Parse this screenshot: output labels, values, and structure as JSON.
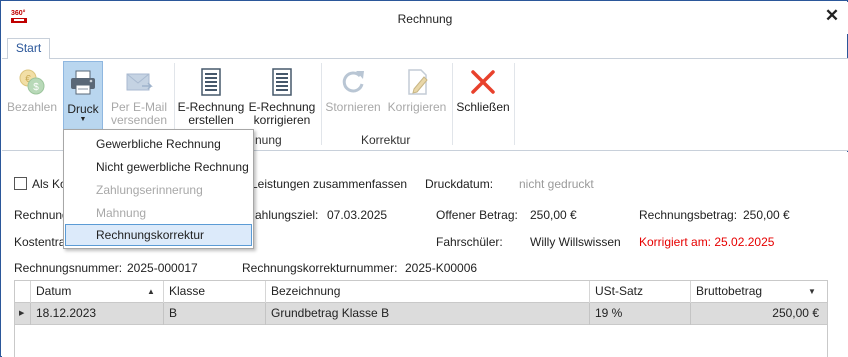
{
  "window": {
    "title": "Rechnung",
    "logo_text": "360°"
  },
  "tabs": [
    {
      "label": "Start"
    }
  ],
  "ribbon": {
    "bezahlen": "Bezahlen",
    "druck": "Druck",
    "email_line1": "Per E-Mail",
    "email_line2": "versenden",
    "erechnung_erstellen_1": "E-Rechnung",
    "erechnung_erstellen_2": "erstellen",
    "erechnung_korrigieren_1": "E-Rechnung",
    "erechnung_korrigieren_2": "korrigieren",
    "stornieren": "Stornieren",
    "korrigieren": "Korrigieren",
    "schliessen": "Schließen",
    "group_rechnung_partial": "nung",
    "group_korrektur": "Korrektur"
  },
  "dropdown": {
    "items": [
      {
        "label": "Gewerbliche Rechnung",
        "enabled": true
      },
      {
        "label": "Nicht gewerbliche Rechnung",
        "enabled": true
      },
      {
        "label": "Zahlungserinnerung",
        "enabled": false
      },
      {
        "label": "Mahnung",
        "enabled": false
      },
      {
        "label": "Rechnungskorrektur",
        "enabled": true,
        "highlighted": true
      }
    ]
  },
  "form": {
    "als_ko_label": "Als Ko",
    "leistungen_label": "Leistungen zusammenfassen",
    "druckdatum_label": "Druckdatum:",
    "druckdatum_value": "nicht gedruckt",
    "rechnung_partial": "Rechnung",
    "zahlungsziel_label": "ahlungsziel:",
    "zahlungsziel_value": "07.03.2025",
    "offener_betrag_label": "Offener Betrag:",
    "offener_betrag_value": "250,00 €",
    "rechnungsbetrag_label": "Rechnungsbetrag:",
    "rechnungsbetrag_value": "250,00 €",
    "kostentra_partial": "Kostentra",
    "fahrschueler_label": "Fahrschüler:",
    "fahrschueler_value": "Willy Willswissen",
    "korrigiert_text": "Korrigiert am: 25.02.2025",
    "rechnungsnummer_label": "Rechnungsnummer:",
    "rechnungsnummer_value": "2025-000017",
    "korrekturnummer_label": "Rechnungskorrekturnummer:",
    "korrekturnummer_value": "2025-K00006"
  },
  "table": {
    "columns": [
      "Datum",
      "Klasse",
      "Bezeichnung",
      "USt-Satz",
      "Bruttobetrag"
    ],
    "rows": [
      {
        "datum": "18.12.2023",
        "klasse": "B",
        "bezeichnung": "Grundbetrag Klasse B",
        "ust": "19 %",
        "brutto": "250,00 €"
      }
    ]
  },
  "colors": {
    "accent": "#2b579a",
    "error": "#e60000",
    "pressed": "#b9d6ef",
    "close_red": "#e8412c"
  },
  "icons": [
    "coins-icon",
    "printer-icon",
    "email-icon",
    "document-icon",
    "refresh-icon",
    "edit-document-icon",
    "close-x-icon"
  ]
}
